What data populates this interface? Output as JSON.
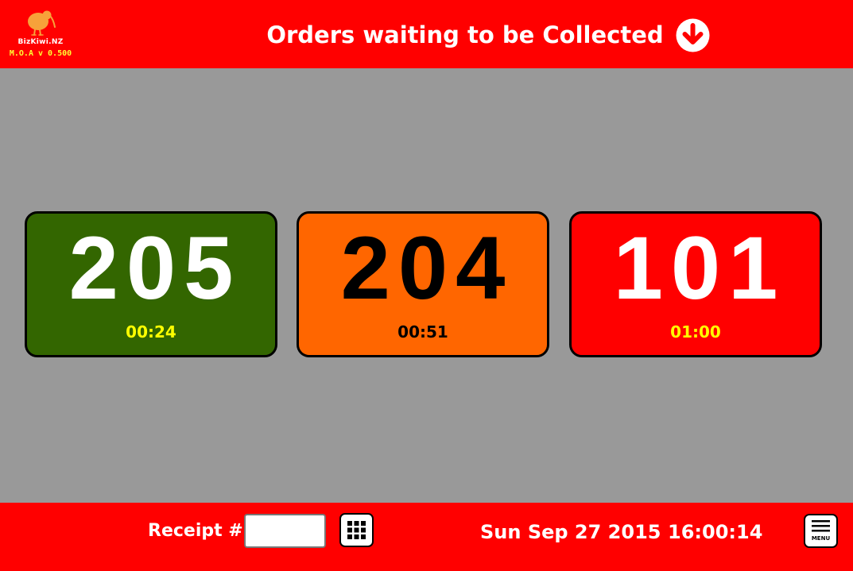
{
  "header": {
    "logo_name": "BizKiwi.NZ",
    "logo_version": "M.O.A v 0.500",
    "title": "Orders waiting to be Collected",
    "logo_icon": "kiwi-bird-icon",
    "action_icon": "arrow-down-circle-icon"
  },
  "orders": [
    {
      "number": "205",
      "elapsed": "00:24",
      "tile_color": "#336600",
      "number_color": "#ffffff",
      "time_color": "#ffff00"
    },
    {
      "number": "204",
      "elapsed": "00:51",
      "tile_color": "#ff6600",
      "number_color": "#000000",
      "time_color": "#000000"
    },
    {
      "number": "101",
      "elapsed": "01:00",
      "tile_color": "#ff0000",
      "number_color": "#ffffff",
      "time_color": "#ffff00"
    }
  ],
  "footer": {
    "receipt_label": "Receipt #",
    "receipt_value": "",
    "keypad_icon": "keypad-grid-icon",
    "date": "Sun Sep 27 2015",
    "time": "16:00:14",
    "menu_label": "MENU",
    "menu_icon": "hamburger-menu-icon"
  },
  "colors": {
    "bar_red": "#ff0000",
    "background_gray": "#999999",
    "version_yellow": "#ffff33",
    "logo_orange": "#f7a23a"
  }
}
